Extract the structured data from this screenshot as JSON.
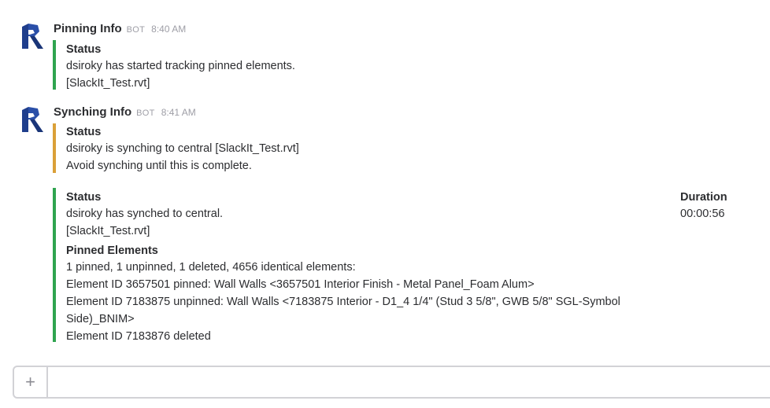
{
  "colors": {
    "status_green": "#2fa44f",
    "status_orange": "#daa038",
    "avatar_blue": "#1f3e8c"
  },
  "messages": [
    {
      "sender": "Pinning Info",
      "badge": "BOT",
      "time": "8:40 AM",
      "avatar_icon": "revit-logo-icon",
      "attachments": [
        {
          "color": "green",
          "status_title": "Status",
          "lines": [
            "dsiroky has started tracking pinned elements.",
            "[SlackIt_Test.rvt]"
          ]
        }
      ]
    },
    {
      "sender": "Synching Info",
      "badge": "BOT",
      "time": "8:41 AM",
      "avatar_icon": "revit-logo-icon",
      "attachments": [
        {
          "color": "orange",
          "status_title": "Status",
          "lines": [
            "dsiroky is synching to central [SlackIt_Test.rvt]",
            "Avoid synching until this is complete."
          ]
        },
        {
          "color": "green",
          "status_title": "Status",
          "lines": [
            "dsiroky has synched to central.",
            "[SlackIt_Test.rvt]"
          ],
          "duration_title": "Duration",
          "duration_value": "00:00:56",
          "pinned_title": "Pinned Elements",
          "pinned_lines": [
            "1 pinned, 1 unpinned, 1 deleted, 4656 identical elements:",
            "Element ID 3657501 pinned:  Wall Walls <3657501 Interior Finish - Metal Panel_Foam Alum>",
            "Element ID 7183875 unpinned:  Wall Walls <7183875 Interior - D1_4 1/4\" (Stud 3 5/8\", GWB 5/8\" SGL-Symbol Side)_BNIM>",
            "Element ID 7183876 deleted"
          ]
        }
      ]
    }
  ],
  "composer": {
    "plus_label": "+",
    "plus_icon": "plus-icon",
    "placeholder": ""
  }
}
